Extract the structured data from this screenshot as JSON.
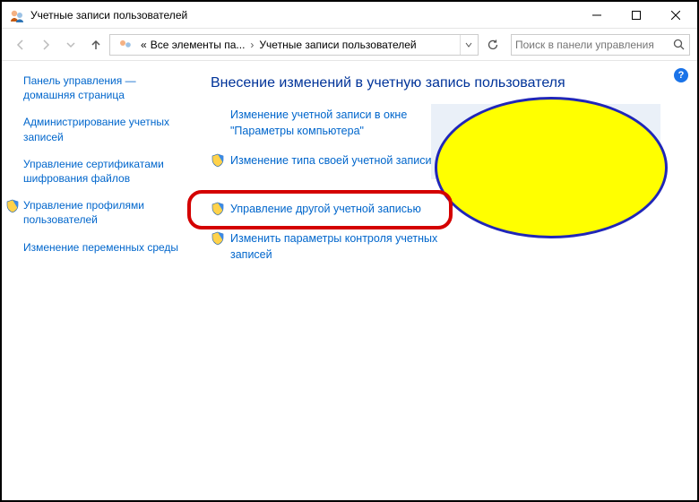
{
  "titlebar": {
    "title": "Учетные записи пользователей"
  },
  "address": {
    "root_prefix": "«",
    "crumb1": "Все элементы па...",
    "crumb2": "Учетные записи пользователей"
  },
  "search": {
    "placeholder": "Поиск в панели управления"
  },
  "sidebar": {
    "home": "Панель управления — домашняя страница",
    "items": [
      {
        "label": "Администрирование учетных записей",
        "shield": false
      },
      {
        "label": "Управление сертификатами шифрования файлов",
        "shield": false
      },
      {
        "label": "Управление профилями пользователей",
        "shield": true
      },
      {
        "label": "Изменение переменных среды",
        "shield": false
      }
    ]
  },
  "main": {
    "heading": "Внесение изменений в учетную запись пользователя",
    "tasks": [
      {
        "label": "Изменение учетной записи в окне \"Параметры компьютера\"",
        "shield": false
      },
      {
        "label": "Изменение типа своей учетной записи",
        "shield": true
      },
      {
        "label": "Управление другой учетной записью",
        "shield": true,
        "highlight": true
      },
      {
        "label": "Изменить параметры контроля учетных записей",
        "shield": true
      }
    ]
  },
  "help": "?"
}
